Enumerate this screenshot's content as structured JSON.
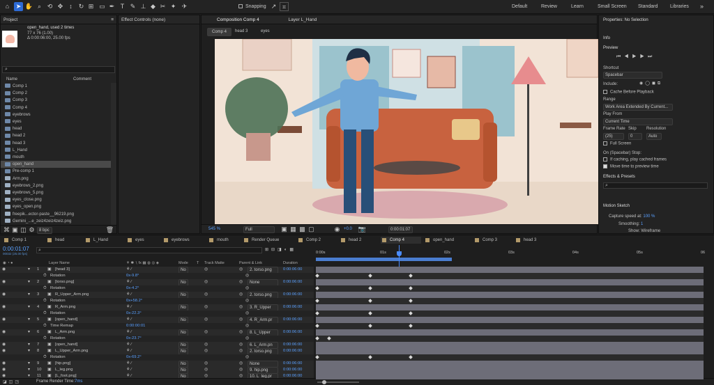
{
  "toolbar": {
    "snapping": "Snapping",
    "workspaces": [
      "Default",
      "Review",
      "Learn",
      "Small Screen",
      "Standard",
      "Libraries"
    ]
  },
  "project": {
    "title": "Project",
    "item_name": "open_hand",
    "used": ", used 2 times",
    "dims": "77 x 76 (1.00)",
    "duration": "Δ 0:00:06:00, 25.00 fps",
    "search_placeholder": "",
    "col_name": "Name",
    "col_comment": "Comment",
    "items": [
      "Comp 1",
      "Comp 2",
      "Comp 3",
      "Comp 4",
      "eyebrows",
      "eyes",
      "head",
      "head 2",
      "head 3",
      "L_Hand",
      "mouth",
      "open_hand",
      "Pre-comp 1",
      "Arm.png",
      "eyebrows_2.png",
      "eyebrows_5.png",
      "eyes_close.png",
      "eyes_open.png",
      "freepik...ector-paste__96219.png",
      "Gemini_...e_zeiz4zeiz4zeiz.png"
    ],
    "bpc": "8 bpc"
  },
  "effect_controls": {
    "title": "Effect Controls (none)"
  },
  "composition": {
    "tab": "Composition Comp 4",
    "layer_tab": "Layer L_Hand",
    "crumbs": [
      "Comp 4",
      "head 3",
      "eyes"
    ],
    "zoom": "545 %",
    "quality": "Full",
    "offset": "+0.0",
    "timecode": "0:00:01:07"
  },
  "right_panel": {
    "properties": "Properties: No Selection",
    "info": "Info",
    "preview": "Preview",
    "shortcut_label": "Shortcut",
    "shortcut": "Spacebar",
    "include": "Include:",
    "cache": "Cache Before Playback",
    "range_label": "Range",
    "range": "Work Area Extended By Current...",
    "playfrom_label": "Play From",
    "playfrom": "Current Time",
    "framerate_label": "Frame Rate",
    "skip_label": "Skip",
    "resolution_label": "Resolution",
    "framerate": "(25)",
    "skip": "0",
    "resolution": "Auto",
    "fullscreen": "Full Screen",
    "stop_label": "On (Spacebar) Stop:",
    "stop1": "If caching, play cached frames",
    "stop2": "Move time to preview time",
    "effects": "Effects & Presets",
    "effects_search": "",
    "motion": "Motion Sketch",
    "capture_label": "Capture speed at:",
    "capture_val": "100 %",
    "smoothing_label": "Smoothing:",
    "smoothing_val": "1",
    "show_label": "Show:",
    "show_val": "Wireframe"
  },
  "timeline": {
    "tabs": [
      "Comp 1",
      "head",
      "L_Hand",
      "eyes",
      "eyebrows",
      "mouth",
      "Render Queue",
      "Comp 2",
      "head 2",
      "Comp 4",
      "open_hand",
      "Comp 3",
      "head 3"
    ],
    "active_tab": "Comp 4",
    "timecode": "0:00:01:07",
    "fps": "00032 (25.00 fps)",
    "headers": {
      "layer_name": "Layer Name",
      "mode": "Mode",
      "t": "T",
      "track_matte": "Track Matte",
      "parent": "Parent & Link",
      "duration": "Duration"
    },
    "ruler": [
      "0:00s",
      "01s",
      "02s",
      "03s",
      "04s",
      "05s",
      "06"
    ],
    "rows": [
      {
        "num": "1",
        "name": "[head 3]",
        "kind": "layer",
        "mode": "No",
        "parent": "2. torso.png",
        "dur": "0:00:06:00"
      },
      {
        "name": "Rotation",
        "kind": "prop",
        "value": "0x-9.8°"
      },
      {
        "num": "2",
        "name": "[torso.png]",
        "kind": "layer",
        "mode": "No",
        "parent": "None",
        "dur": "0:00:06:00"
      },
      {
        "name": "Rotation",
        "kind": "prop",
        "value": "0x-4.2°"
      },
      {
        "num": "3",
        "name": "R_Upper_Arm.png",
        "kind": "layer",
        "mode": "No",
        "parent": "2. torso.png",
        "dur": "0:00:06:00"
      },
      {
        "name": "Rotation",
        "kind": "prop",
        "value": "0x+58.2°"
      },
      {
        "num": "4",
        "name": "R_Arm.png",
        "kind": "layer",
        "mode": "No",
        "parent": "3. R_Upper",
        "dur": "0:00:06:00"
      },
      {
        "name": "Rotation",
        "kind": "prop",
        "value": "0x-22.3°"
      },
      {
        "num": "5",
        "name": "[open_hand]",
        "kind": "layer",
        "mode": "No",
        "parent": "4. R_Arm.pr",
        "dur": "0:00:06:00"
      },
      {
        "name": "Time Remap",
        "kind": "prop",
        "value": "0:00:00:01"
      },
      {
        "num": "6",
        "name": "L_Arm.png",
        "kind": "layer",
        "mode": "No",
        "parent": "8. L_Upper",
        "dur": "0:00:06:00"
      },
      {
        "name": "Rotation",
        "kind": "prop",
        "value": "0x-23.7°"
      },
      {
        "num": "7",
        "name": "[open_hand]",
        "kind": "layer",
        "mode": "No",
        "parent": "6. L_Arm.pn",
        "dur": "0:00:06:00"
      },
      {
        "num": "8",
        "name": "L_Upper_Arm.png",
        "kind": "layer",
        "mode": "No",
        "parent": "2. torso.png",
        "dur": "0:00:06:00"
      },
      {
        "name": "Rotation",
        "kind": "prop",
        "value": "0x-69.2°"
      },
      {
        "num": "9",
        "name": "[hip.png]",
        "kind": "layer",
        "mode": "No",
        "parent": "None",
        "dur": "0:00:06:00"
      },
      {
        "num": "10",
        "name": "L_leg.png",
        "kind": "layer",
        "mode": "No",
        "parent": "9. hip.png",
        "dur": "0:00:06:00"
      },
      {
        "num": "11",
        "name": "[L_foot.png]",
        "kind": "layer",
        "mode": "No",
        "parent": "10. L_leg.pr",
        "dur": "0:00:06:00"
      }
    ],
    "render_time_label": "Frame Render Time:",
    "render_time": "7ms"
  }
}
